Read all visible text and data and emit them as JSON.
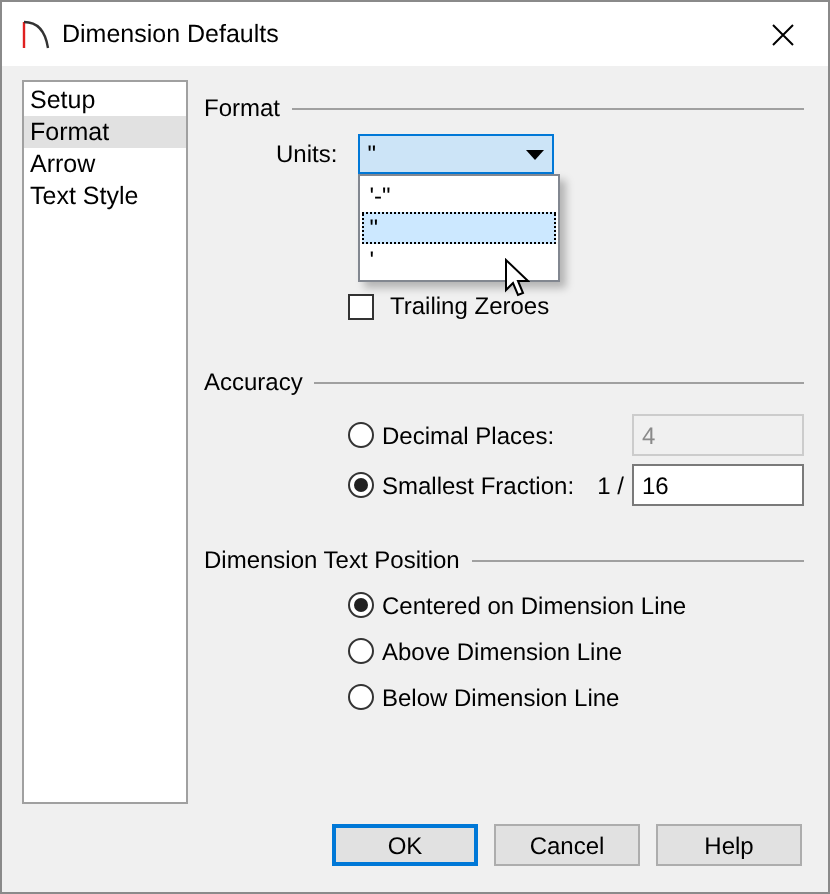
{
  "window": {
    "title": "Dimension Defaults"
  },
  "sidebar": {
    "items": [
      {
        "label": "Setup",
        "selected": false
      },
      {
        "label": "Format",
        "selected": true
      },
      {
        "label": "Arrow",
        "selected": false
      },
      {
        "label": "Text Style",
        "selected": false
      }
    ]
  },
  "format": {
    "heading": "Format",
    "units": {
      "label": "Units:",
      "value": "\"",
      "expanded": true,
      "options": [
        {
          "label": "'-\"",
          "selected": false
        },
        {
          "label": "\"",
          "selected": true
        },
        {
          "label": "'",
          "selected": false
        }
      ]
    },
    "trailing_zeroes": {
      "label": "Trailing Zeroes",
      "checked": false
    }
  },
  "accuracy": {
    "heading": "Accuracy",
    "options": [
      {
        "label": "Decimal Places:",
        "selected": false,
        "value": "4",
        "disabled": true
      },
      {
        "label": "Smallest Fraction:",
        "selected": true,
        "prefix": "1 /",
        "value": "16",
        "disabled": false
      }
    ]
  },
  "text_position": {
    "heading": "Dimension Text Position",
    "options": [
      {
        "label": "Centered on Dimension Line",
        "selected": true
      },
      {
        "label": "Above Dimension Line",
        "selected": false
      },
      {
        "label": "Below Dimension Line",
        "selected": false
      }
    ]
  },
  "buttons": [
    {
      "label": "OK",
      "default": true
    },
    {
      "label": "Cancel",
      "default": false
    },
    {
      "label": "Help",
      "default": false
    }
  ]
}
